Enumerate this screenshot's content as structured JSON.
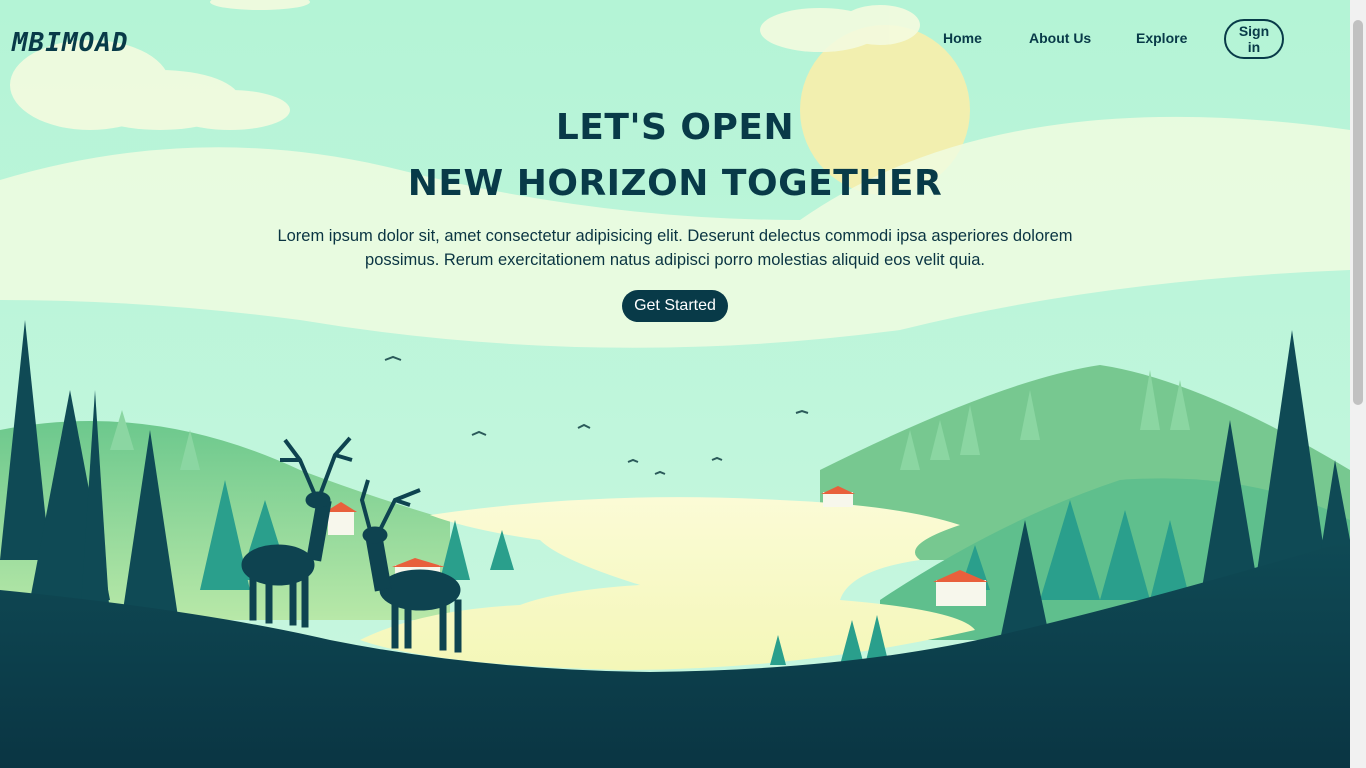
{
  "brand": {
    "logo_text": "MBIMOAD"
  },
  "nav": {
    "links": [
      "Home",
      "About Us",
      "Explore"
    ],
    "signin_label": "Sign in"
  },
  "hero": {
    "title_line1": "LET'S OPEN",
    "title_line2": "NEW HORIZON TOGETHER",
    "description": "Lorem ipsum dolor sit, amet consectetur adipisicing elit. Deserunt delectus commodi ipsa asperiores dolorem possimus. Rerum exercitationem natus adipisci porro molestias aliquid eos velit quia.",
    "cta_label": "Get Started"
  },
  "colors": {
    "primary": "#083a48",
    "sky": "#b6f5d7",
    "sun": "#fdf3b4",
    "lake": "#fbfcd2",
    "hill_light": "#8fd9a8",
    "tree_teal": "#2e9e8e"
  }
}
